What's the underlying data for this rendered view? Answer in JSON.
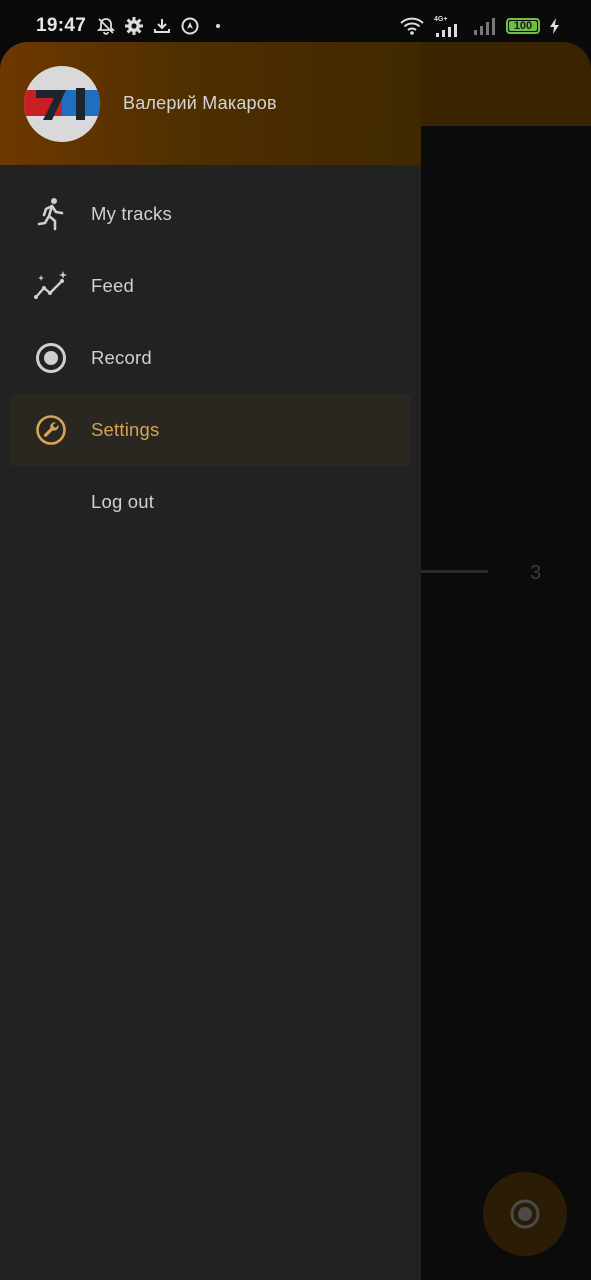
{
  "status_bar": {
    "time": "19:47",
    "left_icons": [
      "bell-off-icon",
      "gear-icon",
      "download-icon",
      "location-icon",
      "dot-icon"
    ],
    "network_label": "4G+",
    "battery_level": "100"
  },
  "background": {
    "number": "3"
  },
  "drawer": {
    "user_name": "Валерий Макаров",
    "avatar_text": "71",
    "menu": [
      {
        "label": "My tracks",
        "icon": "running-person-icon",
        "active": false
      },
      {
        "label": "Feed",
        "icon": "sparkle-chart-icon",
        "active": false
      },
      {
        "label": "Record",
        "icon": "record-icon",
        "active": false
      },
      {
        "label": "Settings",
        "icon": "wrench-icon",
        "active": true
      },
      {
        "label": "Log out",
        "icon": "",
        "active": false
      }
    ]
  },
  "colors": {
    "accent": "#d7a356",
    "drawer_bg": "#222222",
    "header_gradient_start": "#6e3800"
  }
}
